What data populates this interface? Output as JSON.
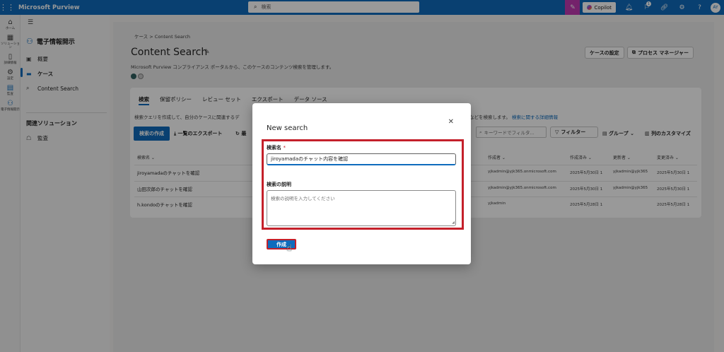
{
  "topbar": {
    "app_title": "Microsoft Purview",
    "search_placeholder": "検索",
    "copilot_label": "Copilot",
    "badge_count": "1",
    "avatar_initials": "AY"
  },
  "rail": {
    "items": [
      {
        "icon": "home-icon",
        "label": "ホーム"
      },
      {
        "icon": "solutions-icon",
        "label": "ソリューション"
      },
      {
        "icon": "learn-icon",
        "label": "詳細情報"
      },
      {
        "icon": "settings-icon",
        "label": "設定"
      },
      {
        "icon": "audit-icon",
        "label": "監査"
      },
      {
        "icon": "ediscovery-icon",
        "label": "電子情報開示"
      }
    ]
  },
  "nav": {
    "case_title": "電子情報開示",
    "items": [
      {
        "icon": "overview-icon",
        "label": "概要"
      },
      {
        "icon": "case-icon",
        "label": "ケース"
      },
      {
        "icon": "search-icon",
        "label": "Content Search"
      }
    ],
    "related_heading": "関連ソリューション",
    "related_items": [
      {
        "icon": "audit-icon",
        "label": "監査"
      }
    ]
  },
  "page": {
    "breadcrumb_1": "ケース",
    "breadcrumb_2": "Content Search",
    "title": "Content Search",
    "description": "Microsoft Purview コンプライアンス ポータルから、このケースのコンテンツ検索を管理します。",
    "case_settings_label": "ケースの設定",
    "process_manager_label": "プロセス マネージャー"
  },
  "tabs": [
    "検索",
    "保留ポリシー",
    "レビュー セット",
    "エクスポート",
    "データ ソース"
  ],
  "toolbar": {
    "intro_text": "検索クエリを作成して、自分のケースに関連するデ",
    "intro_right": "などを検索します。",
    "intro_link": "検索に関する詳細情報",
    "create_search_label": "検索の作成",
    "export_list_label": "一覧のエクスポート",
    "refresh_label": "最",
    "keyword_filter_placeholder": "キーワードでフィルタ...",
    "filter_label": "フィルター",
    "group_label": "グループ",
    "customize_columns_label": "列のカスタマイズ"
  },
  "table": {
    "headers": {
      "name": "検索名",
      "creator": "作成者",
      "created": "作成済み",
      "modified_by": "更新者",
      "modified": "変更済み"
    },
    "rows": [
      {
        "name": "jiroyamadaのチャットを確認",
        "creator": "yjkadmin@yjk365.onmicrosoft.com",
        "created": "2025年5月30日 1",
        "modified_by": "yjkadmin@yjk365",
        "modified": "2025年5月30日 1"
      },
      {
        "name": "山田次郎のチャットを確認",
        "creator": "yjkadmin@yjk365.onmicrosoft.com",
        "created": "2025年5月30日 1",
        "modified_by": "yjkadmin@yjk365",
        "modified": "2025年5月30日 1"
      },
      {
        "name": "h.kondoのチャットを確認",
        "creator": "yjkadmin",
        "created": "2025年5月28日 1",
        "modified_by": "",
        "modified": "2025年5月28日 1"
      }
    ]
  },
  "dialog": {
    "title": "New search",
    "name_label": "検索名",
    "required_mark": "*",
    "name_value": "jiroyamadaのチャット内容を確認",
    "desc_label": "検索の説明",
    "desc_placeholder": "検索の説明を入力してください",
    "create_label": "作成"
  },
  "colors": {
    "brand": "#0f6cbd",
    "highlight": "#c4202a",
    "copilot_tile": "#c239b3"
  }
}
